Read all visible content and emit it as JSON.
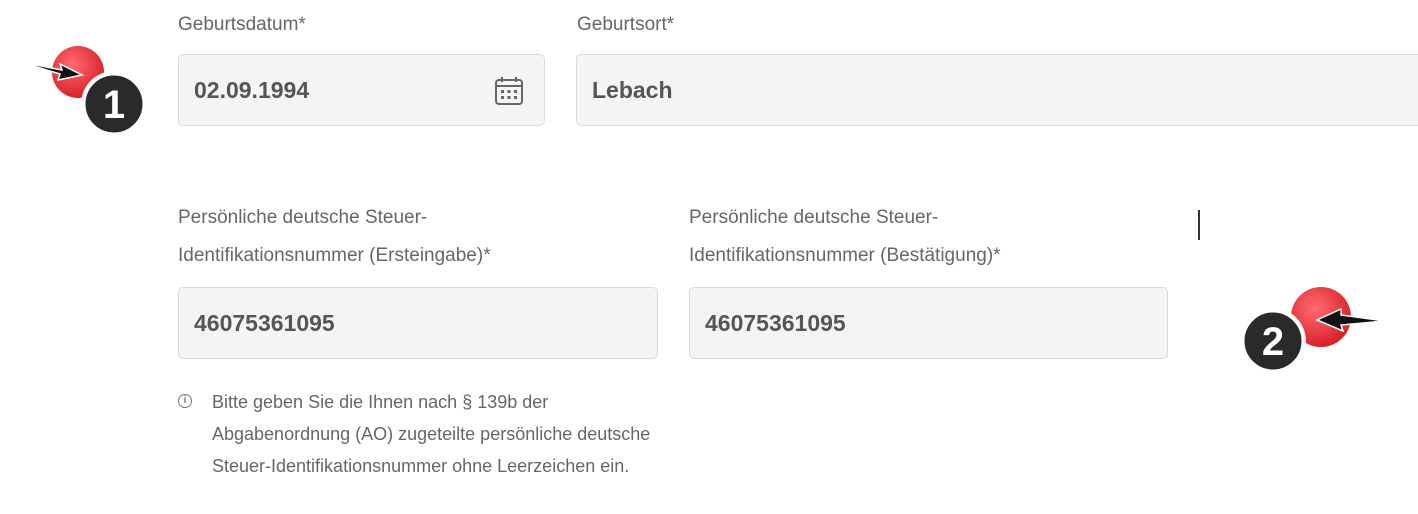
{
  "birth": {
    "date_label": "Geburtsdatum*",
    "date_value": "02.09.1994",
    "place_label": "Geburtsort*",
    "place_value": "Lebach"
  },
  "tax": {
    "first_label_line1": "Persönliche deutsche Steuer-",
    "first_label_line2": "Identifikationsnummer (Ersteingabe)*",
    "first_value": "46075361095",
    "confirm_label_line1": "Persönliche deutsche Steuer-",
    "confirm_label_line2": "Identifikationsnummer (Bestätigung)*",
    "confirm_value": "46075361095"
  },
  "help": {
    "icon": "info-icon",
    "symbol": "i",
    "text": "Bitte geben Sie die Ihnen nach § 139b der Abgabenordnung (AO) zugeteilte persönliche deutsche Steuer-Identifikationsnummer ohne Leerzeichen ein."
  },
  "annotations": {
    "marker1": "1",
    "marker2": "2",
    "marker_color": "#e8333a",
    "badge_color": "#2a2a2a"
  }
}
